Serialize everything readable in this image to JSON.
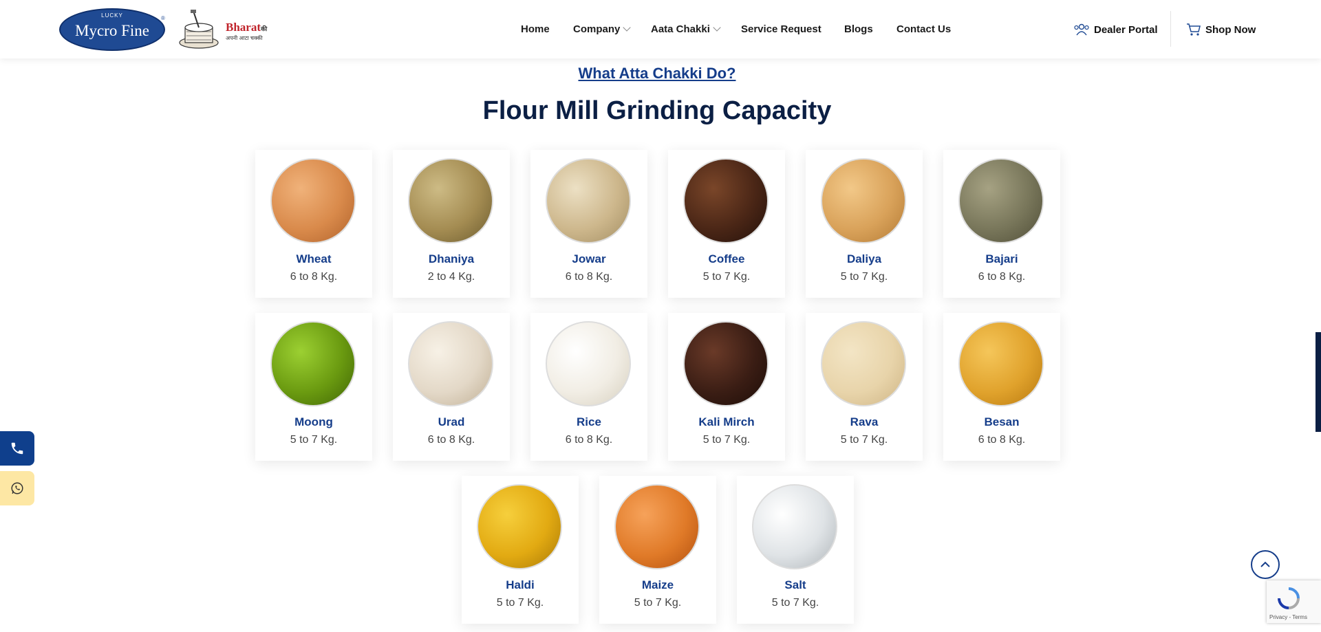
{
  "header": {
    "logo_top": "LUCKY",
    "logo_main": "Mycro Fine",
    "logo_reg": "®",
    "bharat_title": "Bharat",
    "bharat_suffix": "की",
    "bharat_sub": "अपनी आटा चक्की",
    "nav": [
      {
        "label": "Home"
      },
      {
        "label": "Company"
      },
      {
        "label": "Aata Chakki"
      },
      {
        "label": "Service Request"
      },
      {
        "label": "Blogs"
      },
      {
        "label": "Contact Us"
      }
    ],
    "dealer_portal": "Dealer Portal",
    "shop_now": "Shop Now"
  },
  "section": {
    "link": "What Atta Chakki Do?",
    "title": "Flour Mill Grinding Capacity"
  },
  "items": [
    {
      "name": "Wheat",
      "capacity": "6 to 8 Kg.",
      "color": "#d98a4b"
    },
    {
      "name": "Dhaniya",
      "capacity": "2 to 4 Kg.",
      "color": "#a48c52"
    },
    {
      "name": "Jowar",
      "capacity": "6 to 8 Kg.",
      "color": "#cdb78c"
    },
    {
      "name": "Coffee",
      "capacity": "5 to 7 Kg.",
      "color": "#4a2616"
    },
    {
      "name": "Daliya",
      "capacity": "5 to 7 Kg.",
      "color": "#d9a25a"
    },
    {
      "name": "Bajari",
      "capacity": "6 to 8 Kg.",
      "color": "#78765a"
    },
    {
      "name": "Moong",
      "capacity": "5 to 7 Kg.",
      "color": "#6a9a10"
    },
    {
      "name": "Urad",
      "capacity": "6 to 8 Kg.",
      "color": "#e3d8c7"
    },
    {
      "name": "Rice",
      "capacity": "6 to 8 Kg.",
      "color": "#f1ede4"
    },
    {
      "name": "Kali Mirch",
      "capacity": "5 to 7 Kg.",
      "color": "#3a1d14"
    },
    {
      "name": "Rava",
      "capacity": "5 to 7 Kg.",
      "color": "#e8d4aa"
    },
    {
      "name": "Besan",
      "capacity": "6 to 8 Kg.",
      "color": "#e0a22c"
    },
    {
      "name": "Haldi",
      "capacity": "5 to 7 Kg.",
      "color": "#e2aa12"
    },
    {
      "name": "Maize",
      "capacity": "5 to 7 Kg.",
      "color": "#e07a28"
    },
    {
      "name": "Salt",
      "capacity": "5 to 7 Kg.",
      "color": "#dfe3e6"
    }
  ],
  "recaptcha": {
    "text": "Privacy - Terms"
  }
}
